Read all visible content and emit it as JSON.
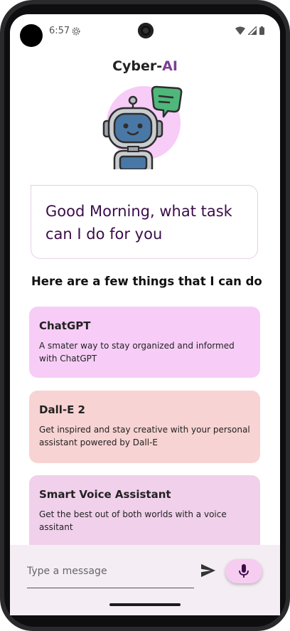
{
  "status_bar": {
    "time": "6:57"
  },
  "header": {
    "title_main": "Cyber-",
    "title_accent": "AI",
    "accent_color": "#7b3f98"
  },
  "greeting": {
    "text": "Good Morning, what task can I do for you"
  },
  "section": {
    "title": "Here are a few things that I can do"
  },
  "features": [
    {
      "title": "ChatGPT",
      "description": "A smater way to stay organized and informed with ChatGPT",
      "color": "#f7cdf7"
    },
    {
      "title": "Dall-E 2",
      "description": "Get inspired and stay creative with your personal assistant powered by Dall-E",
      "color": "#f8d3d3"
    },
    {
      "title": "Smart Voice Assistant",
      "description": "Get the best out of both worlds with a voice assitant",
      "color": "#f0d0eb"
    }
  ],
  "composer": {
    "placeholder": "Type a message",
    "send_icon": "send-icon",
    "mic_icon": "mic-icon"
  }
}
